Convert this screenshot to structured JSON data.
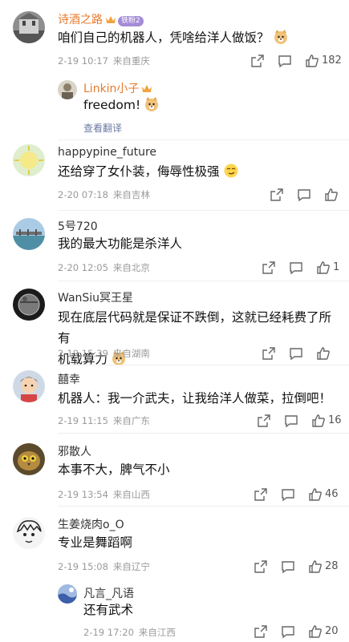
{
  "comments": [
    {
      "username": "诗酒之路",
      "level": "铁粉2",
      "text": "咱们自己的机器人，凭啥给洋人做饭？",
      "date": "2-19 10:17",
      "location": "来自重庆",
      "likes": "182",
      "reply": {
        "username": "Linkin小子",
        "text": "freedom!",
        "translate": "查看翻译"
      }
    },
    {
      "username": "happypine_future",
      "text": "还给穿了女仆装，侮辱性极强",
      "date": "2-20 07:18",
      "location": "来自吉林"
    },
    {
      "username": "5号720",
      "text": "我的最大功能是杀洋人",
      "date": "2-20 12:05",
      "location": "来自北京",
      "likes": "1"
    },
    {
      "username": "WanSiu冥王星",
      "text_line1": "现在底层代码就是保证不跌倒，这就已经耗费了所有",
      "text_line2": "机载算力",
      "date": "2-19 15:39",
      "location": "来自湖南"
    },
    {
      "username": "囍幸",
      "text": "机器人：我一介武夫，让我给洋人做菜，拉倒吧！",
      "date": "2-19 11:15",
      "location": "来自广东",
      "likes": "16"
    },
    {
      "username": "邪散人",
      "text": "本事不大，脾气不小",
      "date": "2-19 13:54",
      "location": "来自山西",
      "likes": "46"
    },
    {
      "username": "生姜烧肉o_O",
      "text": "专业是舞蹈啊",
      "date": "2-19 15:08",
      "location": "来自辽宁",
      "likes": "28",
      "reply": {
        "username": "凡言_凡语",
        "text": "还有武术",
        "date": "2-19 17:20",
        "location": "来自江西",
        "likes": "20"
      }
    }
  ],
  "colors": {
    "vip_name": "#e8792b",
    "meta": "#9a9a9a",
    "translate": "#6b7aa1"
  }
}
